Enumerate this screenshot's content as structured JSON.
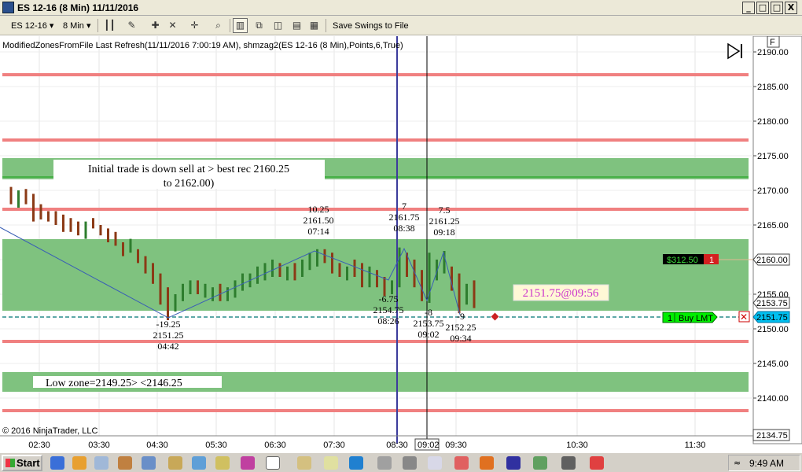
{
  "window": {
    "title": "ES 12-16 (8 Min)  11/11/2016",
    "minimize": "_",
    "restore": "□",
    "close": "X"
  },
  "toolbar": {
    "instrument": "ES 12-16",
    "interval": "8 Min",
    "save_swings": "Save Swings to File"
  },
  "chart": {
    "info_line": "ModifiedZonesFromFile Last Refresh(11/11/2016 7:00:19 AM), shmzag2(ES 12-16 (8 Min),Points,6,True)",
    "copyright": "© 2016 NinjaTrader, LLC",
    "price_axis": [
      "2190.00",
      "2185.00",
      "2180.00",
      "2175.00",
      "2170.00",
      "2165.00",
      "2160.00",
      "2155.00",
      "2150.00",
      "2145.00",
      "2140.00"
    ],
    "time_axis": [
      "02:30",
      "03:30",
      "04:30",
      "05:30",
      "06:30",
      "07:30",
      "08:30",
      "09:30",
      "10:30",
      "11:30"
    ],
    "cursor_time": "09:02",
    "price_markers": {
      "last": "2153.75",
      "order": "2151.75",
      "low": "2134.75",
      "position": "2160.00"
    },
    "position_label": "$312.50",
    "position_qty": "1",
    "order_qty": "1",
    "order_label": "Buy LMT",
    "annotations": {
      "initial_trade_line1": "Initial trade is down sell at > best rec 2160.25",
      "initial_trade_line2": "to 2162.00)",
      "low_zone": "Low  zone=2149.25>  <2146.25",
      "price_at_time": "2151.75@09:56"
    },
    "swing_labels": [
      {
        "a": "-19.25",
        "b": "2151.25",
        "c": "04:42"
      },
      {
        "a": "10.25",
        "b": "2161.50",
        "c": "07:14"
      },
      {
        "a": "-6.75",
        "b": "2154.75",
        "c": "08:26"
      },
      {
        "a": "7",
        "b": "2161.75",
        "c": "08:38"
      },
      {
        "a": "-8",
        "b": "2153.75",
        "c": "09:02"
      },
      {
        "a": "7.5",
        "b": "2161.25",
        "c": "09:18"
      },
      {
        "a": "-9",
        "b": "2152.25",
        "c": "09:34"
      }
    ]
  },
  "taskbar": {
    "start": "Start",
    "clock": "9:49 AM"
  },
  "colors": {
    "zone_green": "#7fc27f",
    "zone_line_green": "#46b046",
    "red_line": "#f08080",
    "bull_bar": "#2e7d2e",
    "bear_bar": "#8b3a16",
    "zigzag": "#3a5fb5",
    "cursor_line_blue": "#3c3c9c"
  }
}
